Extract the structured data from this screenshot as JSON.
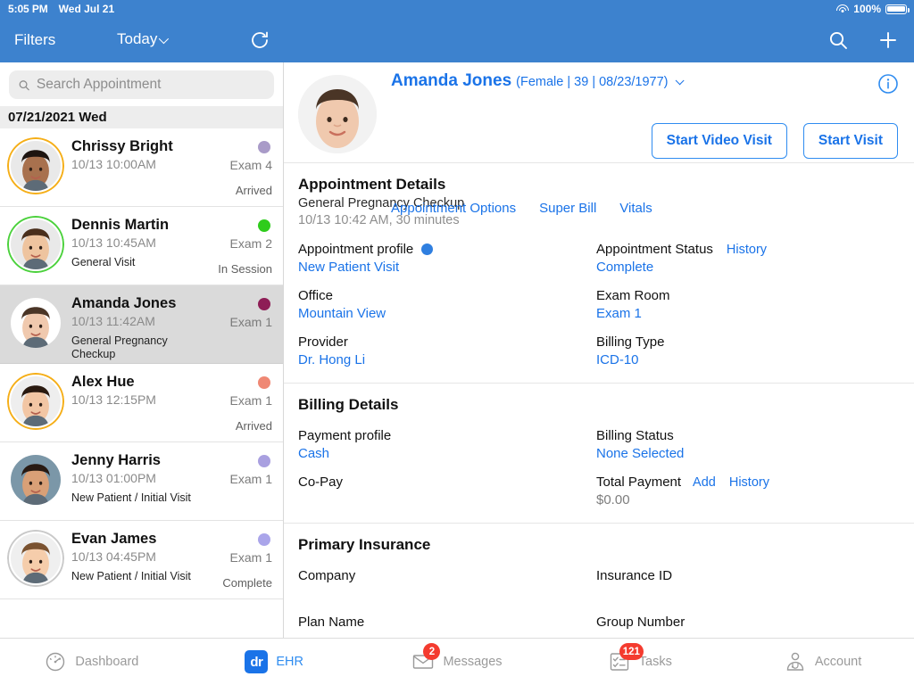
{
  "statusbar": {
    "time": "5:05 PM",
    "date": "Wed Jul 21",
    "battery": "100%"
  },
  "navbar": {
    "filters_label": "Filters",
    "today_label": "Today",
    "refresh_icon": "refresh-icon",
    "search_icon": "search-icon",
    "add_icon": "plus-icon"
  },
  "sidebar": {
    "search": {
      "value": "",
      "placeholder": "Search Appointment",
      "icon": "search-icon"
    },
    "date_header": "07/21/2021 Wed",
    "appointments": [
      {
        "name": "Chrissy Bright",
        "time": "10/13 10:00AM",
        "reason": "",
        "room": "Exam 4",
        "status": "Arrived",
        "dot_color": "#a99bc8",
        "ring_color": "#f5ae17",
        "selected": false
      },
      {
        "name": "Dennis Martin",
        "time": "10/13 10:45AM",
        "reason": "General Visit",
        "room": "Exam 2",
        "status": "In Session",
        "dot_color": "#2ecc1b",
        "ring_color": "#4bd13c",
        "selected": false
      },
      {
        "name": "Amanda Jones",
        "time": "10/13 11:42AM",
        "reason": "General Pregnancy Checkup",
        "room": "Exam 1",
        "status": "",
        "dot_color": "#8e1e56",
        "ring_color": "",
        "selected": true
      },
      {
        "name": "Alex Hue",
        "time": "10/13 12:15PM",
        "reason": "",
        "room": "Exam 1",
        "status": "Arrived",
        "dot_color": "#ef8874",
        "ring_color": "#f5ae17",
        "selected": false
      },
      {
        "name": "Jenny Harris",
        "time": "10/13 01:00PM",
        "reason": "New Patient / Initial Visit",
        "room": "Exam 1",
        "status": "",
        "dot_color": "#a9a0e0",
        "ring_color": "",
        "selected": false
      },
      {
        "name": "Evan James",
        "time": "10/13 04:45PM",
        "reason": "New Patient / Initial Visit",
        "room": "Exam 1",
        "status": "Complete",
        "dot_color": "#aaa5ea",
        "ring_color": "#c9c9c9",
        "selected": false
      }
    ]
  },
  "patient_header": {
    "name": "Amanda Jones",
    "meta": "(Female | 39 | 08/23/1977)",
    "links": [
      "Appointment Options",
      "Super Bill",
      "Vitals"
    ],
    "buttons": [
      "Start Video Visit",
      "Start Visit"
    ],
    "info_icon": "info-icon"
  },
  "appointment_details": {
    "title": "Appointment Details",
    "visit_type": "General Pregnancy Checkup",
    "when": "10/13 10:42 AM, 30 minutes",
    "fields": [
      {
        "label": "Appointment profile",
        "value": "New Patient Visit",
        "dot": "#2f7fe0",
        "link": ""
      },
      {
        "label": "Appointment Status",
        "value": "Complete",
        "dot": "",
        "link": "History"
      },
      {
        "label": "Office",
        "value": "Mountain View",
        "dot": "",
        "link": ""
      },
      {
        "label": "Exam Room",
        "value": "Exam 1",
        "dot": "",
        "link": ""
      },
      {
        "label": "Provider",
        "value": "Dr. Hong Li",
        "dot": "",
        "link": ""
      },
      {
        "label": "Billing Type",
        "value": "ICD-10",
        "dot": "",
        "link": ""
      }
    ]
  },
  "billing_details": {
    "title": "Billing Details",
    "fields": [
      {
        "label": "Payment profile",
        "value": "Cash",
        "link": "",
        "link2": "",
        "gray": false
      },
      {
        "label": "Billing Status",
        "value": "None Selected",
        "link": "",
        "link2": "",
        "gray": false
      },
      {
        "label": "Co-Pay",
        "value": "",
        "link": "",
        "link2": "",
        "gray": false
      },
      {
        "label": "Total Payment",
        "value": "$0.00",
        "link": "Add",
        "link2": "History",
        "gray": true
      }
    ]
  },
  "primary_insurance": {
    "title": "Primary Insurance",
    "fields": [
      {
        "label": "Company",
        "value": ""
      },
      {
        "label": "Insurance ID",
        "value": ""
      },
      {
        "label": "Plan Name",
        "value": ""
      },
      {
        "label": "Group Number",
        "value": ""
      }
    ]
  },
  "tabbar": {
    "tabs": [
      {
        "label": "Dashboard",
        "icon": "dashboard-gauge-icon",
        "badge": "",
        "active": false
      },
      {
        "label": "EHR",
        "icon": "dr-logo-icon",
        "badge": "",
        "active": true
      },
      {
        "label": "Messages",
        "icon": "envelope-icon",
        "badge": "2",
        "active": false
      },
      {
        "label": "Tasks",
        "icon": "checklist-icon",
        "badge": "121",
        "active": false
      },
      {
        "label": "Account",
        "icon": "doctor-person-icon",
        "badge": "",
        "active": false
      }
    ]
  },
  "colors": {
    "brand_blue": "#3d82ce",
    "link_blue": "#1a73e8",
    "badge_red": "#f43b2f"
  }
}
